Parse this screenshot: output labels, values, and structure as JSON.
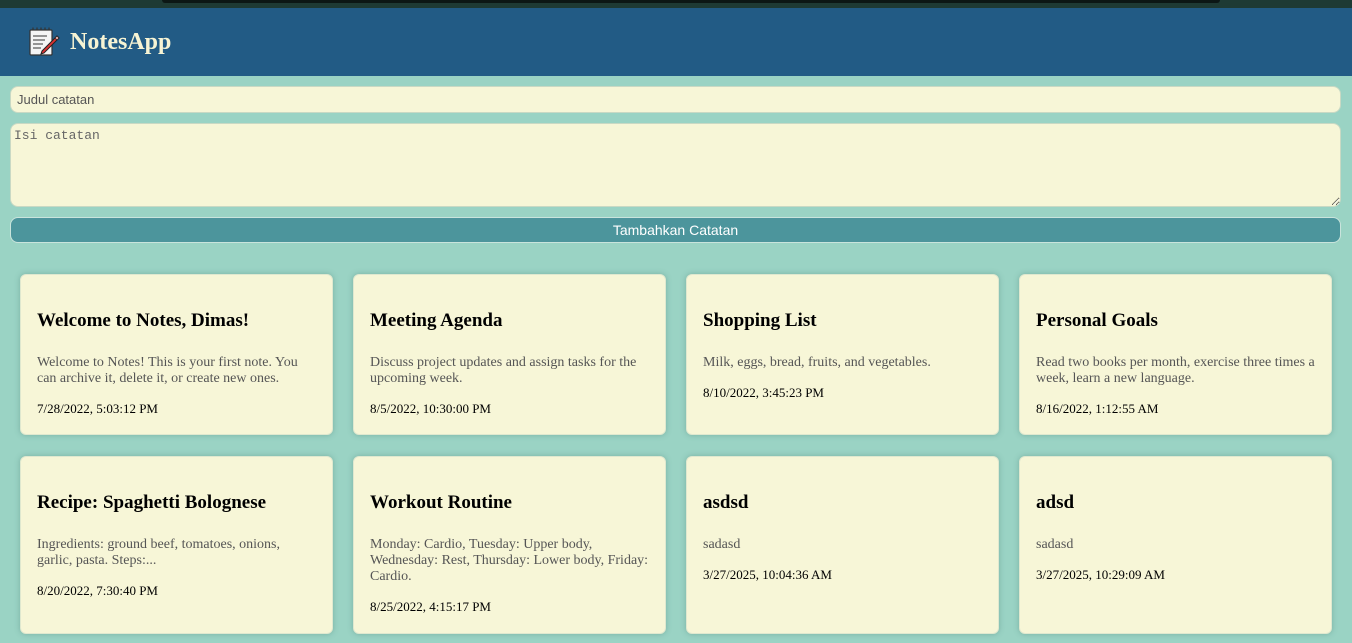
{
  "app": {
    "title": "NotesApp",
    "logo_icon": "memo-pencil-icon"
  },
  "form": {
    "title_placeholder": "Judul catatan",
    "body_placeholder": "Isi catatan",
    "submit_label": "Tambahkan Catatan"
  },
  "notes": [
    {
      "title": "Welcome to Notes, Dimas!",
      "body": "Welcome to Notes! This is your first note. You can archive it, delete it, or create new ones.",
      "date": "7/28/2022, 5:03:12 PM"
    },
    {
      "title": "Meeting Agenda",
      "body": "Discuss project updates and assign tasks for the upcoming week.",
      "date": "8/5/2022, 10:30:00 PM"
    },
    {
      "title": "Shopping List",
      "body": "Milk, eggs, bread, fruits, and vegetables.",
      "date": "8/10/2022, 3:45:23 PM"
    },
    {
      "title": "Personal Goals",
      "body": "Read two books per month, exercise three times a week, learn a new language.",
      "date": "8/16/2022, 1:12:55 AM"
    },
    {
      "title": "Recipe: Spaghetti Bolognese",
      "body": "Ingredients: ground beef, tomatoes, onions, garlic, pasta. Steps:...",
      "date": "8/20/2022, 7:30:40 PM"
    },
    {
      "title": "Workout Routine",
      "body": "Monday: Cardio, Tuesday: Upper body, Wednesday: Rest, Thursday: Lower body, Friday: Cardio.",
      "date": "8/25/2022, 4:15:17 PM"
    },
    {
      "title": "asdsd",
      "body": "sadasd",
      "date": "3/27/2025, 10:04:36 AM"
    },
    {
      "title": "adsd",
      "body": "sadasd",
      "date": "3/27/2025, 10:29:09 AM"
    }
  ],
  "colors": {
    "header": "#225b85",
    "background": "#9ad3c4",
    "card": "#f7f6d7",
    "button": "#4c959c"
  }
}
